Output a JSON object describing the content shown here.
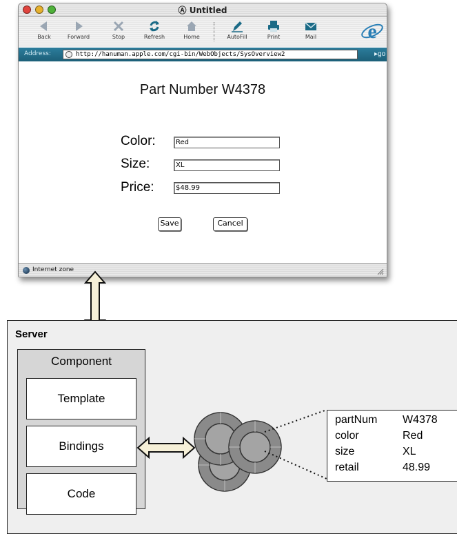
{
  "browser": {
    "window_title": "Untitled",
    "toolbar": {
      "back": "Back",
      "forward": "Forward",
      "stop": "Stop",
      "refresh": "Refresh",
      "home": "Home",
      "autofill": "AutoFill",
      "print": "Print",
      "mail": "Mail"
    },
    "address": {
      "label": "Address:",
      "url": "http://hanuman.apple.com/cgi-bin/WebObjects/SysOverview2",
      "go": "go"
    },
    "page": {
      "title": "Part Number W4378",
      "fields": [
        {
          "label": "Color:",
          "value": "Red"
        },
        {
          "label": "Size:",
          "value": "XL"
        },
        {
          "label": "Price:",
          "value": "$48.99"
        }
      ],
      "save_label": "Save",
      "cancel_label": "Cancel"
    },
    "status": {
      "zone": "Internet zone"
    }
  },
  "server": {
    "label": "Server",
    "component": {
      "label": "Component",
      "parts": [
        "Template",
        "Bindings",
        "Code"
      ]
    },
    "object": {
      "properties": [
        {
          "key": "partNum",
          "value": "W4378"
        },
        {
          "key": "color",
          "value": "Red"
        },
        {
          "key": "size",
          "value": "XL"
        },
        {
          "key": "retail",
          "value": "48.99"
        }
      ]
    }
  },
  "colors": {
    "address_bar": "#1c5f78",
    "arrow_fill": "#f6f0d8",
    "server_bg": "#efefef",
    "component_bg": "#d6d6d6",
    "disk_gray": "#8a8a8a"
  }
}
